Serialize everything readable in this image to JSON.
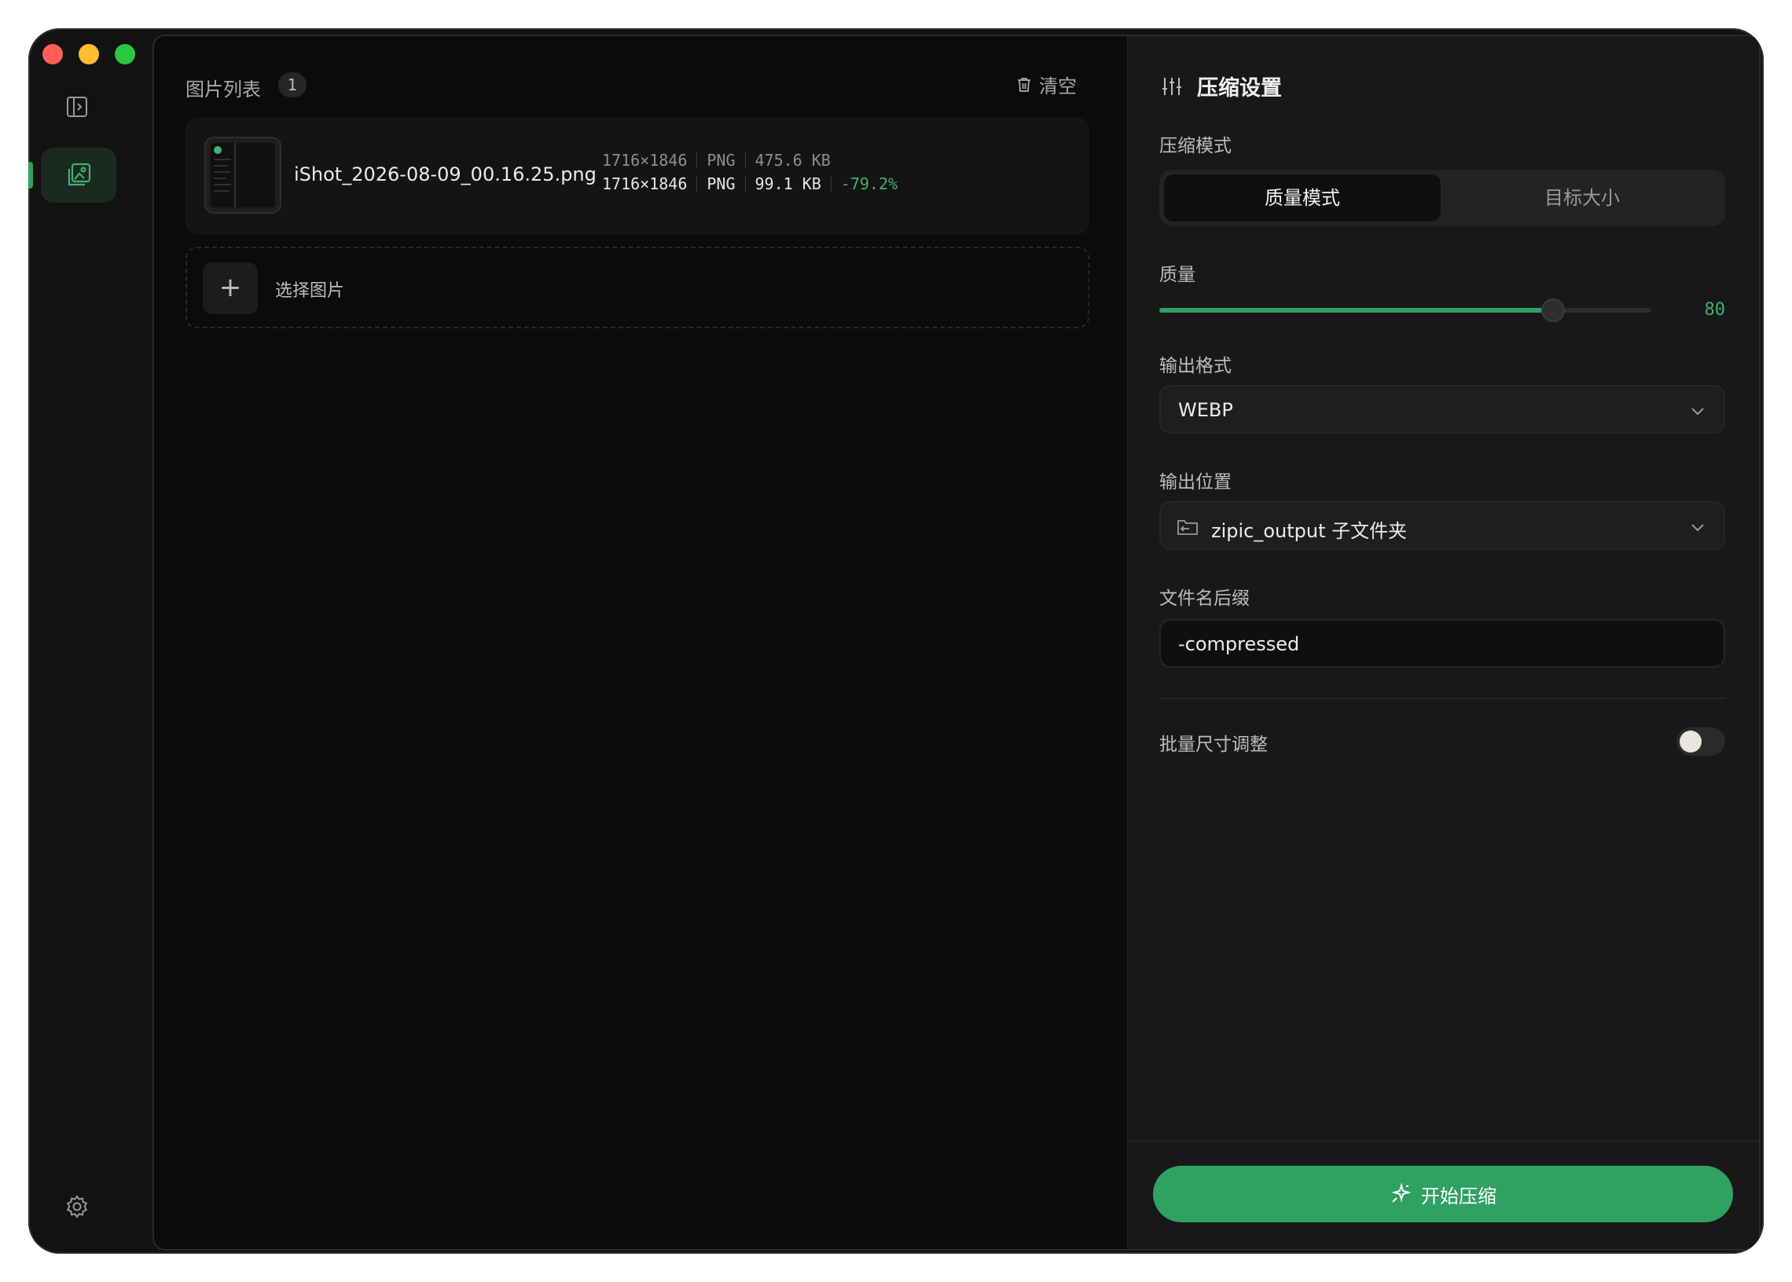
{
  "window": {
    "sidebar": {
      "active_item": "images"
    },
    "colors": {
      "accent": "#2fa160",
      "accent_text": "#3fb36f",
      "background": "#121212"
    }
  },
  "list": {
    "title": "图片列表",
    "count": "1",
    "clear_label": "清空",
    "files": [
      {
        "name": "iShot_2026-08-09_00.16.25.png",
        "original": {
          "dimensions": "1716×1846",
          "format": "PNG",
          "size": "475.6 KB"
        },
        "compressed": {
          "dimensions": "1716×1846",
          "format": "PNG",
          "size": "99.1 KB",
          "ratio": "-79.2%"
        }
      }
    ],
    "add_label": "选择图片"
  },
  "settings": {
    "title": "压缩设置",
    "mode_label": "压缩模式",
    "modes": [
      "质量模式",
      "目标大小"
    ],
    "active_mode": 0,
    "quality_label": "质量",
    "quality_value": "80",
    "quality_percent": 80,
    "format_label": "输出格式",
    "format_value": "WEBP",
    "location_label": "输出位置",
    "location_value": "zipic_output 子文件夹",
    "suffix_label": "文件名后缀",
    "suffix_value": "-compressed",
    "batch_resize_label": "批量尺寸调整",
    "batch_resize_enabled": false,
    "start_button": "开始压缩"
  }
}
